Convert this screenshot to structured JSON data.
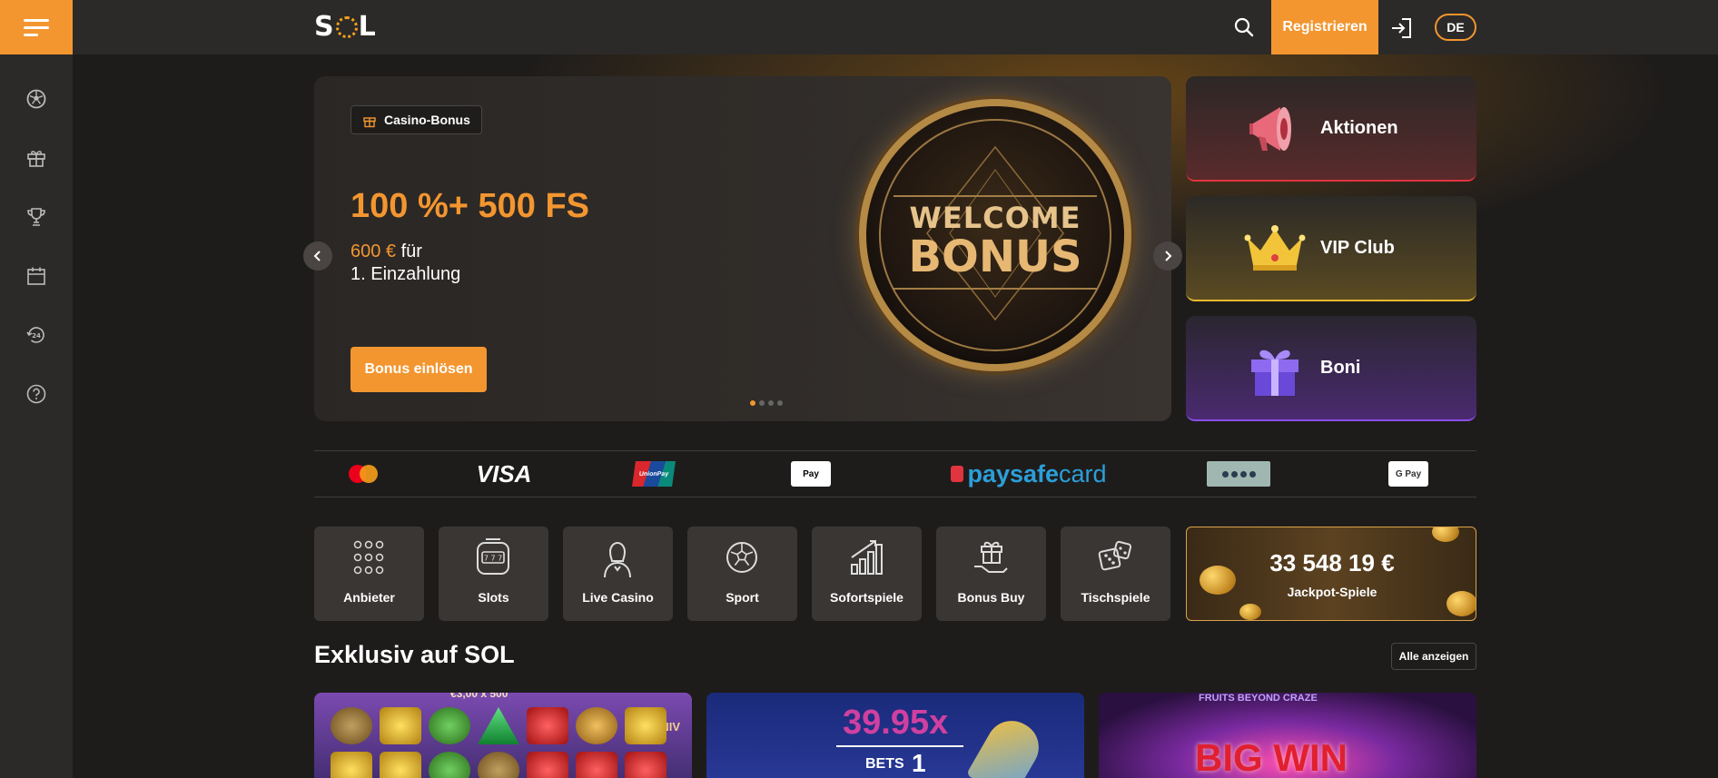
{
  "header": {
    "logo_text_left": "S",
    "logo_text_right": "L",
    "register_label": "Registrieren",
    "language": "DE"
  },
  "sidebar": {
    "items": [
      {
        "icon": "soccer-ball-icon"
      },
      {
        "icon": "gift-icon"
      },
      {
        "icon": "trophy-icon"
      },
      {
        "icon": "calendar-icon"
      },
      {
        "icon": "support-24-icon"
      },
      {
        "icon": "help-icon"
      }
    ]
  },
  "hero": {
    "badge": "Casino-Bonus",
    "title": "100 %+ 500 FS",
    "amount": "600 €",
    "amount_suffix": " für",
    "subtitle2": "1. Einzahlung",
    "cta": "Bonus einlösen",
    "coin_line1": "WELCOME",
    "coin_line2": "BONUS",
    "slides_total": 4,
    "slide_active": 1
  },
  "promos": [
    {
      "label": "Aktionen",
      "icon": "megaphone-icon",
      "accent": "#e0343f"
    },
    {
      "label": "VIP Club",
      "icon": "crown-icon",
      "accent": "#e8b830"
    },
    {
      "label": "Boni",
      "icon": "gift-box-icon",
      "accent": "#8a4ee8"
    }
  ],
  "payments": {
    "visa": "VISA",
    "unionpay": "UnionPay",
    "applepay": "Pay",
    "paysafe_a": "paysafe",
    "paysafe_b": "card",
    "googlepay": "G Pay"
  },
  "categories": [
    {
      "label": "Anbieter",
      "icon": "grid-dots-icon"
    },
    {
      "label": "Slots",
      "icon": "slot-machine-icon"
    },
    {
      "label": "Live Casino",
      "icon": "dealer-icon"
    },
    {
      "label": "Sport",
      "icon": "soccer-ball-icon"
    },
    {
      "label": "Sofortspiele",
      "icon": "bar-chart-icon"
    },
    {
      "label": "Bonus Buy",
      "icon": "gift-hand-icon"
    },
    {
      "label": "Tischspiele",
      "icon": "dice-icon"
    }
  ],
  "jackpot": {
    "amount": "33 548 19",
    "currency": "€",
    "label": "Jackpot-Spiele"
  },
  "section": {
    "title": "Exklusiv auf SOL",
    "see_all": "Alle anzeigen"
  },
  "games": [
    {
      "banner": "€3,00 x 500",
      "side_text": "UNIV"
    },
    {
      "multiplier": "39.95x",
      "bets_label": "BETS",
      "bets_value": "1"
    },
    {
      "top_text": "FRUITS BEYOND CRAZE",
      "big_text": "BIG WIN"
    }
  ],
  "colors": {
    "accent": "#f39630",
    "background": "#1e1c1b",
    "panel": "#2c2a28"
  }
}
